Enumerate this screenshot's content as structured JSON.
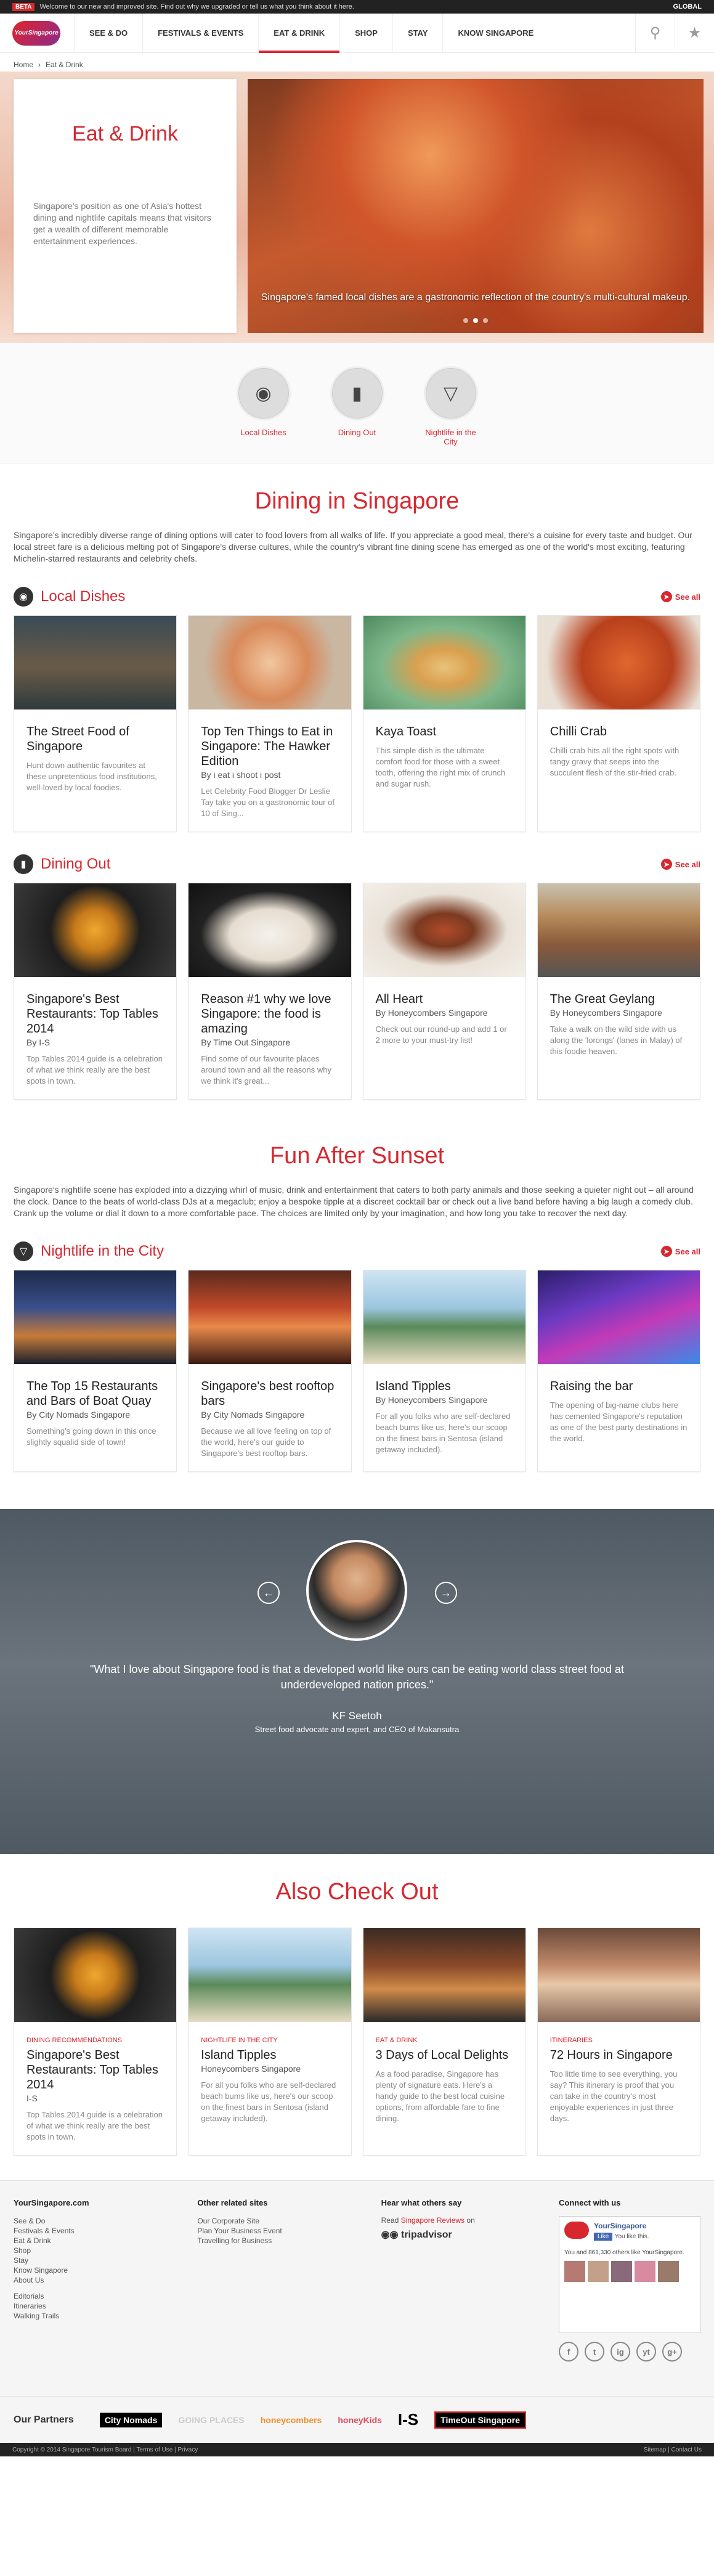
{
  "beta_bar": {
    "tag": "BETA",
    "text": "Welcome to our new and improved site. Find out why we upgraded or tell us what you think about it here.",
    "region": "GLOBAL"
  },
  "nav": {
    "logo": "YourSingapore",
    "items": [
      "SEE & DO",
      "FESTIVALS & EVENTS",
      "EAT & DRINK",
      "SHOP",
      "STAY",
      "KNOW SINGAPORE"
    ],
    "active": "EAT & DRINK"
  },
  "breadcrumb": [
    "Home",
    "Eat & Drink"
  ],
  "hero": {
    "title": "Eat & Drink",
    "description": "Singapore's position as one of Asia's hottest dining and nightlife capitals means that visitors get a wealth of different memorable entertainment experiences.",
    "caption": "Singapore's famed local dishes are a gastronomic reflection of the country's multi-cultural makeup."
  },
  "subnav": [
    {
      "label": "Local Dishes",
      "icon": "plate-icon"
    },
    {
      "label": "Dining Out",
      "icon": "bottle-icon"
    },
    {
      "label": "Nightlife in the City",
      "icon": "cocktail-icon"
    }
  ],
  "dining": {
    "title": "Dining in Singapore",
    "intro": "Singapore's incredibly diverse range of dining options will cater to food lovers from all walks of life. If you appreciate a good meal, there's a cuisine for every taste and budget. Our local street fare is a delicious melting pot of Singapore's diverse cultures, while the country's vibrant fine dining scene has emerged as one of the world's most exciting, featuring Michelin-starred restaurants and celebrity chefs."
  },
  "see_all": "See all",
  "local_dishes": {
    "title": "Local Dishes",
    "cards": [
      {
        "title": "The Street Food of Singapore",
        "by": "",
        "desc": "Hunt down authentic favourites at these unpretentious food institutions, well-loved by local foodies."
      },
      {
        "title": "Top Ten Things to Eat in Singapore: The Hawker Edition",
        "by": "By i eat i shoot i post",
        "desc": "Let Celebrity Food Blogger Dr Leslie Tay take you on a gastronomic tour of 10 of Sing..."
      },
      {
        "title": "Kaya Toast",
        "by": "",
        "desc": "This simple dish is the ultimate comfort food for those with a sweet tooth, offering the right mix of crunch and sugar rush."
      },
      {
        "title": "Chilli Crab",
        "by": "",
        "desc": "Chilli crab hits all the right spots with tangy gravy that seeps into the succulent flesh of the stir-fried crab."
      }
    ]
  },
  "dining_out": {
    "title": "Dining Out",
    "cards": [
      {
        "title": "Singapore's Best Restaurants: Top Tables 2014",
        "by": "By I-S",
        "desc": "Top Tables 2014 guide is a celebration of what we think really are the best spots in town."
      },
      {
        "title": "Reason #1 why we love Singapore: the food is amazing",
        "by": "By Time Out Singapore",
        "desc": "Find some of our favourite places around town and all the reasons why we think it's great..."
      },
      {
        "title": "All Heart",
        "by": "By Honeycombers Singapore",
        "desc": "Check out our round-up and add 1 or 2 more to your must-try list!"
      },
      {
        "title": "The Great Geylang",
        "by": "By Honeycombers Singapore",
        "desc": "Take a walk on the wild side with us along the 'lorongs' (lanes in Malay) of this foodie heaven."
      }
    ]
  },
  "fun": {
    "title": "Fun After Sunset",
    "intro": "Singapore's nightlife scene has exploded into a dizzying whirl of music, drink and entertainment that caters to both party animals and those seeking a quieter night out – all around the clock. Dance to the beats of world-class DJs at a megaclub; enjoy a bespoke tipple at a discreet cocktail bar or check out a live band before having a big laugh a comedy club. Crank up the volume or dial it down to a more comfortable pace. The choices are limited only by your imagination, and how long you take to recover the next day."
  },
  "nightlife": {
    "title": "Nightlife in the City",
    "cards": [
      {
        "title": "The Top 15 Restaurants and Bars of Boat Quay",
        "by": "By City Nomads Singapore",
        "desc": "Something's going down in this once slightly squalid side of town!"
      },
      {
        "title": "Singapore's best rooftop bars",
        "by": "By City Nomads Singapore",
        "desc": "Because we all love feeling on top of the world, here's our guide to Singapore's best rooftop bars."
      },
      {
        "title": "Island Tipples",
        "by": "By Honeycombers Singapore",
        "desc": "For all you folks who are self-declared beach bums like us, here's our scoop on the finest bars in Sentosa (island getaway included)."
      },
      {
        "title": "Raising the bar",
        "by": "",
        "desc": "The opening of big-name clubs here has cemented Singapore's reputation as one of the best party destinations in the world."
      }
    ]
  },
  "testimonial": {
    "quote": "\"What I love about Singapore food is that a developed world like ours can be eating world class street food at underdeveloped nation prices.\"",
    "author": "KF Seetoh",
    "author_title": "Street food advocate and expert, and CEO of Makansutra"
  },
  "also": {
    "title": "Also Check Out",
    "cards": [
      {
        "tag": "DINING RECOMMENDATIONS",
        "title": "Singapore's Best Restaurants: Top Tables 2014",
        "by": "I-S",
        "desc": "Top Tables 2014 guide is a celebration of what we think really are the best spots in town."
      },
      {
        "tag": "NIGHTLIFE IN THE CITY",
        "title": "Island Tipples",
        "by": "Honeycombers Singapore",
        "desc": "For all you folks who are self-declared beach bums like us, here's our scoop on the finest bars in Sentosa (island getaway included)."
      },
      {
        "tag": "EAT & DRINK",
        "title": "3 Days of Local Delights",
        "by": "",
        "desc": "As a food paradise, Singapore has plenty of signature eats. Here's a handy guide to the best local cuisine options, from affordable fare to fine dining."
      },
      {
        "tag": "ITINERARIES",
        "title": "72 Hours in Singapore",
        "by": "",
        "desc": "Too little time to see everything, you say? This itinerary is proof that you can take in the country's most enjoyable experiences in just three days."
      }
    ]
  },
  "footer": {
    "col1_title": "YourSingapore.com",
    "col1_links": [
      "See & Do",
      "Festivals & Events",
      "Eat & Drink",
      "Shop",
      "Stay",
      "Know Singapore",
      "About Us",
      "",
      "Editorials",
      "Itineraries",
      "Walking Trails"
    ],
    "col2_title": "Other related sites",
    "col2_links": [
      "Our Corporate Site",
      "Plan Your Business Event",
      "Travelling for Business"
    ],
    "col3_title": "Hear what others say",
    "col3_text": "Read",
    "col3_link": "Singapore Reviews",
    "col3_on": "on",
    "tripadvisor": "tripadvisor",
    "col4_title": "Connect with us",
    "fb_name": "YourSingapore",
    "fb_like": "Like",
    "fb_you_like": "You like this.",
    "fb_count": "You and 861,330 others like YourSingapore.",
    "social": [
      "f",
      "t",
      "ig",
      "yt",
      "g+"
    ]
  },
  "partners": {
    "title": "Our Partners",
    "items": [
      "City Nomads",
      "GOING PLACES",
      "honeycombers",
      "honeyKids",
      "I-S",
      "TimeOut Singapore"
    ]
  },
  "bottom": {
    "left": "Copyright © 2014 Singapore Tourism Board  |  Terms of Use  |  Privacy",
    "right": "Sitemap  |  Contact Us"
  },
  "colors": {
    "accent": "#d7282f",
    "dark": "#222222"
  }
}
